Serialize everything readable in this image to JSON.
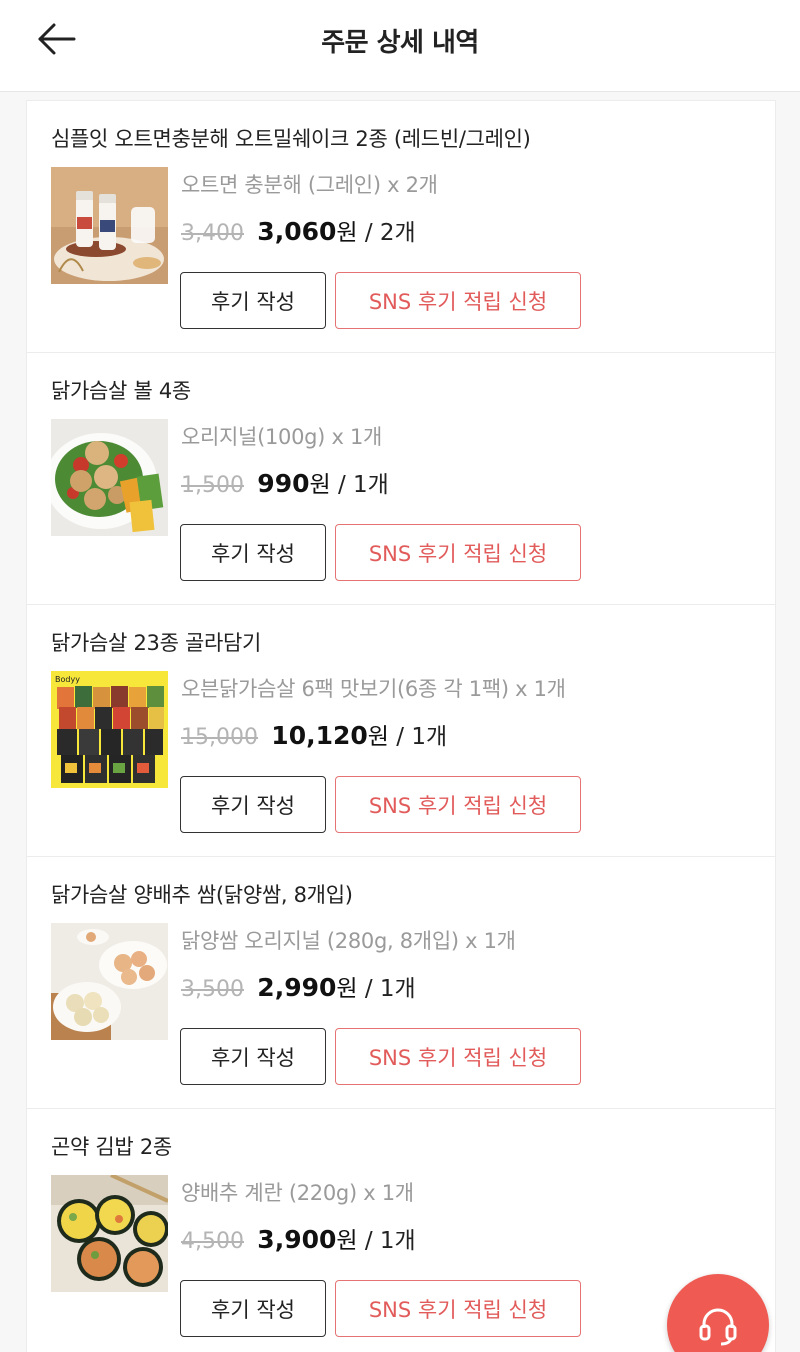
{
  "header": {
    "title": "주문 상세 내역",
    "back_icon": "arrow-left-icon"
  },
  "items": [
    {
      "name": "심플잇 오트면충분해 오트밀쉐이크 2종 (레드빈/그레인)",
      "option": "오트면 충분해 (그레인) x 2개",
      "original_price": "3,400",
      "sale_price": "3,060",
      "won": "원",
      "qty": "/ 2개",
      "review_label": "후기 작성",
      "sns_label": "SNS 후기 적립 신청"
    },
    {
      "name": "닭가슴살 볼 4종",
      "option": "오리지널(100g) x 1개",
      "original_price": "1,500",
      "sale_price": "990",
      "won": "원",
      "qty": "/ 1개",
      "review_label": "후기 작성",
      "sns_label": "SNS 후기 적립 신청"
    },
    {
      "name": "닭가슴살 23종 골라담기",
      "option": "오븐닭가슴살 6팩 맛보기(6종 각 1팩) x 1개",
      "original_price": "15,000",
      "sale_price": "10,120",
      "won": "원",
      "qty": "/ 1개",
      "review_label": "후기 작성",
      "sns_label": "SNS 후기 적립 신청",
      "thumb_brand": "Bodyy"
    },
    {
      "name": "닭가슴살 양배추 쌈(닭양쌈, 8개입)",
      "option": "닭양쌈 오리지널 (280g, 8개입) x 1개",
      "original_price": "3,500",
      "sale_price": "2,990",
      "won": "원",
      "qty": "/ 1개",
      "review_label": "후기 작성",
      "sns_label": "SNS 후기 적립 신청"
    },
    {
      "name": "곤약 김밥 2종",
      "option": "양배추 계란 (220g) x 1개",
      "original_price": "4,500",
      "sale_price": "3,900",
      "won": "원",
      "qty": "/ 1개",
      "review_label": "후기 작성",
      "sns_label": "SNS 후기 적립 신청"
    }
  ],
  "fab": {
    "icon": "headset-icon",
    "color": "#ef5b53"
  },
  "colors": {
    "sns_border": "#e57373",
    "sns_text": "#e25b5b",
    "strike_price": "#b4b4b4",
    "option_text": "#9a9a9a"
  }
}
